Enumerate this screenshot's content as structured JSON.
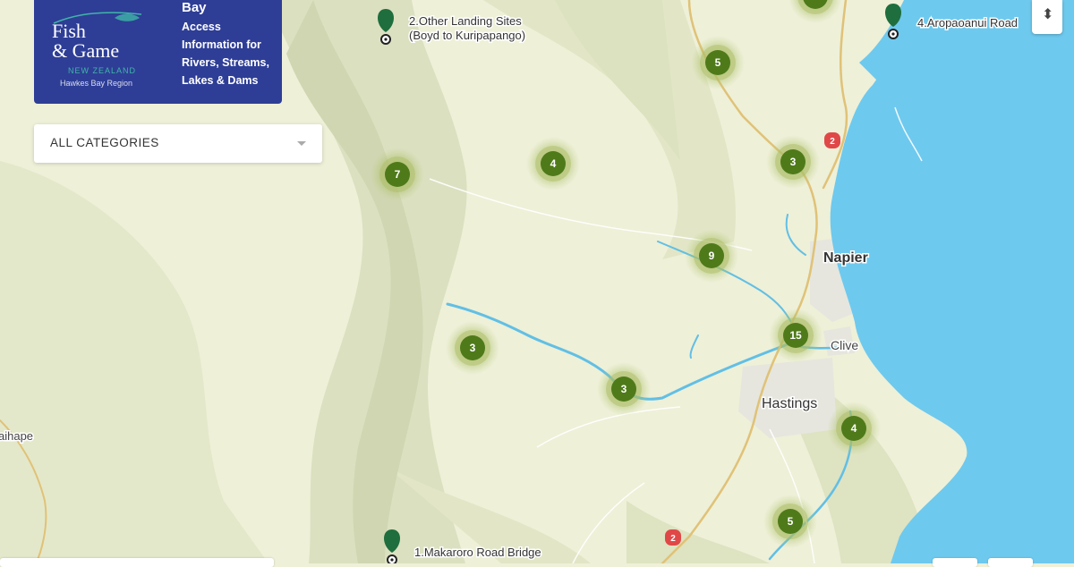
{
  "brand": {
    "line1": "Fish",
    "line2": "& Game",
    "country": "NEW ZEALAND",
    "region": "Hawkes Bay Region",
    "heading": "Bay",
    "subtitle": "Access Information for Rivers, Streams, Lakes & Dams"
  },
  "filter": {
    "selected": "ALL CATEGORIES"
  },
  "zoom": {
    "icon": "compass-arrows-icon",
    "glyph": "⬍"
  },
  "clusters": [
    {
      "id": "c1",
      "count": "7"
    },
    {
      "id": "c2",
      "count": "4"
    },
    {
      "id": "c3",
      "count": "5"
    },
    {
      "id": "c4",
      "count": "3"
    },
    {
      "id": "c5",
      "count": "9"
    },
    {
      "id": "c6",
      "count": "15"
    },
    {
      "id": "c7",
      "count": "3"
    },
    {
      "id": "c8",
      "count": "3"
    },
    {
      "id": "c9",
      "count": "4"
    },
    {
      "id": "c10",
      "count": "5"
    },
    {
      "id": "c11",
      "count": ""
    }
  ],
  "markers": [
    {
      "id": "m1",
      "label": "2.Other Landing Sites",
      "label2": "(Boyd to Kuripapango)"
    },
    {
      "id": "m2",
      "label": "4.Aropaoanui Road",
      "label2": ""
    },
    {
      "id": "m3",
      "label": "1.Makaroro Road Bridge",
      "label2": ""
    }
  ],
  "places": [
    {
      "id": "napier",
      "name": "Napier"
    },
    {
      "id": "clive",
      "name": "Clive"
    },
    {
      "id": "hastings",
      "name": "Hastings"
    },
    {
      "id": "taihape",
      "name": "aihape"
    }
  ],
  "road_shields": [
    "2",
    "2"
  ],
  "colors": {
    "land": "#eef0d8",
    "sea": "#6ec9ee",
    "river": "#61bfe5",
    "cluster": "#4f7a1a",
    "marker": "#1f6e3d",
    "brand": "#2e3e96"
  }
}
